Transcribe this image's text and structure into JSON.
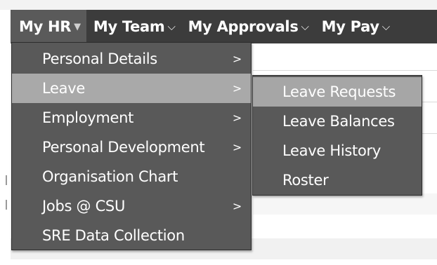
{
  "nav": {
    "items": [
      {
        "label": "My HR",
        "chevron": "chevron-down-icon"
      },
      {
        "label": "My Team",
        "chevron": "chevron-down-icon"
      },
      {
        "label": "My Approvals",
        "chevron": "chevron-down-icon"
      },
      {
        "label": "My Pay",
        "chevron": "chevron-down-icon"
      }
    ]
  },
  "menu": {
    "items": [
      {
        "label": "Personal Details",
        "has_submenu": true
      },
      {
        "label": "Leave",
        "has_submenu": true
      },
      {
        "label": "Employment",
        "has_submenu": true
      },
      {
        "label": "Personal Development",
        "has_submenu": true
      },
      {
        "label": "Organisation Chart",
        "has_submenu": false
      },
      {
        "label": "Jobs @ CSU",
        "has_submenu": true
      },
      {
        "label": "SRE Data Collection",
        "has_submenu": false
      }
    ]
  },
  "submenu": {
    "items": [
      {
        "label": "Leave Requests"
      },
      {
        "label": "Leave Balances"
      },
      {
        "label": "Leave History"
      },
      {
        "label": "Roster"
      }
    ]
  },
  "colors": {
    "nav_bg": "#3c3c3c",
    "nav_active_bg": "#5a5a5a",
    "menu_bg": "#595959",
    "menu_highlight": "#a9a9a9"
  }
}
